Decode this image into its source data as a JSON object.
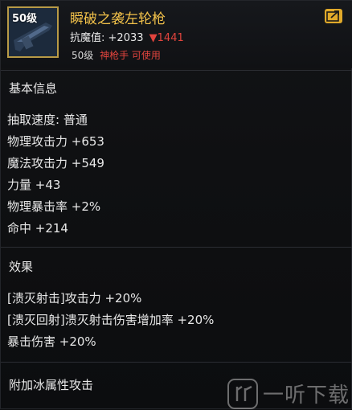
{
  "item": {
    "level_badge": "50级",
    "name": "瞬破之袭左轮枪",
    "stat_label": "抗魔值:",
    "stat_value": "+2033",
    "stat_diff": "▼1441",
    "req_level": "50级",
    "req_class": "神枪手 可使用"
  },
  "basic_info": {
    "title": "基本信息",
    "lines": [
      "抽取速度: 普通",
      "物理攻击力 +653",
      "魔法攻击力 +549",
      "力量 +43",
      "物理暴击率 +2%",
      "命中 +214"
    ]
  },
  "effect": {
    "title": "效果",
    "lines": [
      "[溃灭射击]攻击力 +20%",
      "[溃灭回射]溃灭射击伤害增加率 +20%",
      "暴击伤害 +20%"
    ]
  },
  "extra": {
    "title": "附加冰属性攻击"
  },
  "watermark": {
    "text": "一听下载"
  },
  "colors": {
    "name": "#f3c24a",
    "negative": "#e0443d",
    "frame": "#b89a46"
  },
  "icons": [
    "revolver-icon",
    "share-icon",
    "watermark-logo-icon"
  ]
}
